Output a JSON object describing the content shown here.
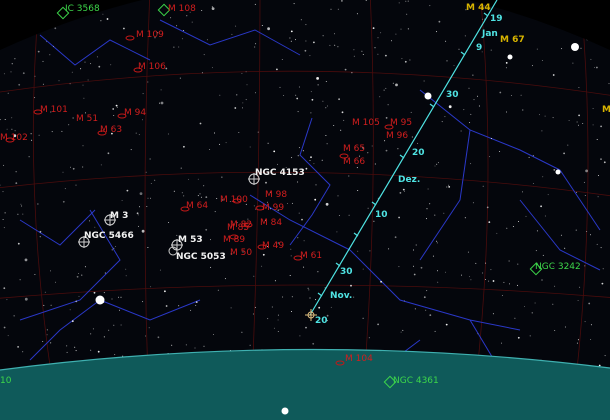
{
  "sky_colors": {
    "background": "#000000",
    "dome": "#04060c",
    "horizon": "#0f5a5a",
    "grid": "#4a0c0c",
    "constellation": "#2a38c8",
    "ecliptic": "#4fe3e3",
    "messier": "#d21e1e",
    "ngc_white": "#f2f2f2",
    "ngc_green": "#3dd64a",
    "gold": "#d8b400"
  },
  "labels": {
    "ic_3568": "IC 3568",
    "m108": "M 108",
    "m44": "M 44",
    "m67": "M 67",
    "m109": "M 109",
    "m106": "M 106",
    "m101": "M 101",
    "m51": "M 51",
    "m63": "M 63",
    "m94": "M 94",
    "m102": "M 102",
    "m105": "M 105",
    "m95": "M 95",
    "m96": "M 96",
    "m65": "M 65",
    "m66": "M 66",
    "ngc4153": "NGC 4153",
    "m98": "M 98",
    "m99": "M 99",
    "m100": "M 100",
    "m64": "M 64",
    "m3": "M 3",
    "m84": "M 84",
    "m82": "M 82",
    "m85": "M 85",
    "m89": "M 89",
    "m53": "M 53",
    "ngc5466": "NGC 5466",
    "ngc5053": "NGC 5053",
    "m49": "M 49",
    "m50": "M 50",
    "m61": "M 61",
    "ngc3242": "NGC 3242",
    "m104": "M 104",
    "ngc4361": "NGC 4361",
    "edge_10": "10",
    "edge_right": "M"
  },
  "path_ticks": {
    "t19": "19",
    "jan": "Jan",
    "t9": "9",
    "t30a": "30",
    "t20a": "20",
    "dez": "Dez.",
    "t10": "10",
    "t30b": "30",
    "nov": "Nov.",
    "t20b": "20"
  }
}
